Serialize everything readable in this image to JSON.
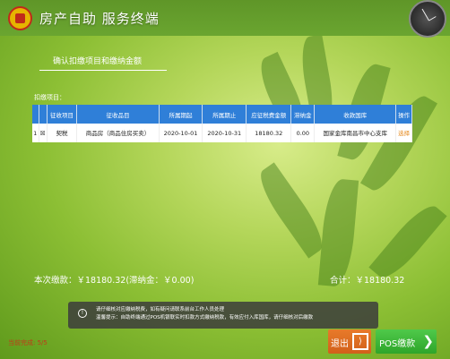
{
  "header": {
    "app_title": "房产自助 服务终端",
    "clock_top": "",
    "clock_bottom": ""
  },
  "page": {
    "subtitle": "确认扣缴项目和缴纳金额",
    "items_label": "扣缴项目："
  },
  "table": {
    "headers": [
      "",
      "",
      "征收项目",
      "征收品目",
      "所属期起",
      "所属期止",
      "应征税费金额",
      "滞纳金",
      "收款国库",
      "操作"
    ],
    "rows": [
      {
        "index": "1",
        "check": "",
        "project": "契税",
        "item": "商品房（商品住房买卖）",
        "start": "2020-10-01",
        "end": "2020-10-31",
        "amount": "18180.32",
        "late_fee": "0.00",
        "treasury": "国家金库南昌市中心支库",
        "action": "选择"
      }
    ]
  },
  "summary": {
    "this_payment": "本次缴款：￥18180.32(滞纳金：￥0.00)",
    "total": "合计：￥18180.32"
  },
  "notice": {
    "line1": "请仔细核对应缴纳税费，如有疑问请联系前台工作人员处理",
    "line2": "温馨提示：自助终端通过POS机银联实时扣款方式缴纳税款，有效应付入库国库，请仔细核对后缴款"
  },
  "status": {
    "text": "当前完成: 5/5"
  },
  "buttons": {
    "exit": "退出",
    "pos_pay": "POS缴款"
  },
  "colors": {
    "table_header": "#2f7fd8",
    "exit_button": "#e87a2a",
    "pos_button": "#3cb836",
    "action_link": "#e58a1f"
  }
}
